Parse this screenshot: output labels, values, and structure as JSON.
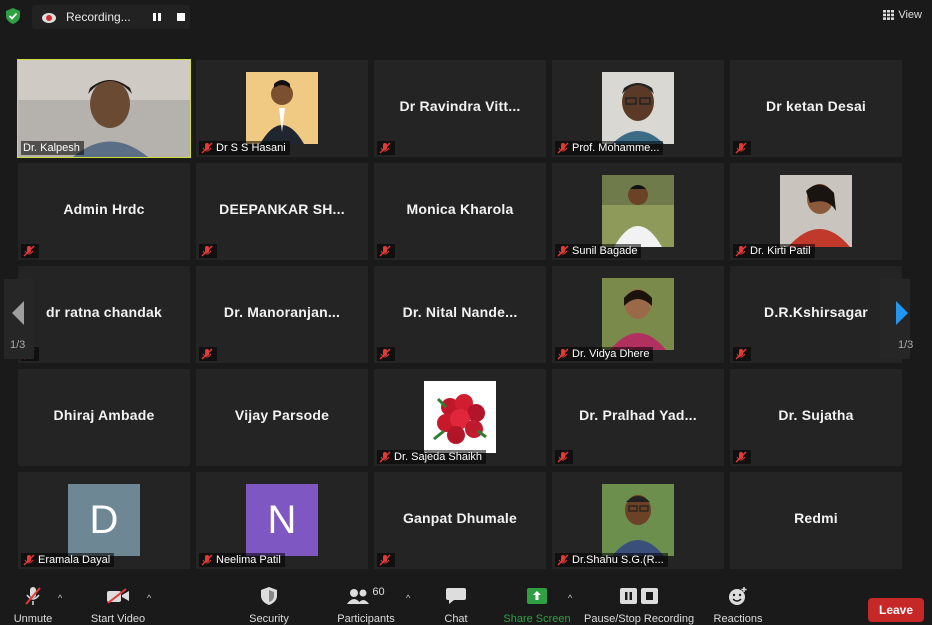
{
  "topbar": {
    "recording_label": "Recording...",
    "view_label": "View"
  },
  "tiles": [
    {
      "name": "",
      "label": "Dr. Kalpesh",
      "type": "video"
    },
    {
      "name": "",
      "label": "Dr S S Hasani",
      "type": "photo"
    },
    {
      "name": "Dr Ravindra Vitt...",
      "label": "",
      "type": "name"
    },
    {
      "name": "",
      "label": "Prof. Mohamme...",
      "type": "photo"
    },
    {
      "name": "Dr ketan Desai",
      "label": "",
      "type": "name"
    },
    {
      "name": "Admin Hrdc",
      "label": "",
      "type": "name"
    },
    {
      "name": "DEEPANKAR SH...",
      "label": "",
      "type": "name"
    },
    {
      "name": "Monica Kharola",
      "label": "",
      "type": "name"
    },
    {
      "name": "",
      "label": "Sunil Bagade",
      "type": "photo"
    },
    {
      "name": "",
      "label": "Dr. Kirti Patil",
      "type": "photo"
    },
    {
      "name": "dr ratna chandak",
      "label": "",
      "type": "name"
    },
    {
      "name": "Dr.  Manoranjan...",
      "label": "",
      "type": "name"
    },
    {
      "name": "Dr. Nital Nande...",
      "label": "",
      "type": "name"
    },
    {
      "name": "",
      "label": "Dr.  Vidya Dhere",
      "type": "photo"
    },
    {
      "name": "D.R.Kshirsagar",
      "label": "",
      "type": "name"
    },
    {
      "name": "Dhiraj Ambade",
      "label": "",
      "type": "name"
    },
    {
      "name": "Vijay Parsode",
      "label": "",
      "type": "name"
    },
    {
      "name": "",
      "label": "Dr. Sajeda Shaikh",
      "type": "photo"
    },
    {
      "name": "Dr. Pralhad  Yad...",
      "label": "",
      "type": "name"
    },
    {
      "name": "Dr. Sujatha",
      "label": "",
      "type": "name"
    },
    {
      "name": "",
      "label": "Eramala Dayal",
      "type": "avatar",
      "initial": "D",
      "color": "#6d8795"
    },
    {
      "name": "",
      "label": "Neelima Patil",
      "type": "avatar",
      "initial": "N",
      "color": "#7e57c2"
    },
    {
      "name": "Ganpat Dhumale",
      "label": "",
      "type": "name"
    },
    {
      "name": "",
      "label": "Dr.Shahu S.G.(R...",
      "type": "photo"
    },
    {
      "name": "Redmi",
      "label": "",
      "type": "name"
    }
  ],
  "pagination": {
    "left": "1/3",
    "right": "1/3"
  },
  "toolbar": {
    "unmute": "Unmute",
    "start_video": "Start Video",
    "security": "Security",
    "participants": "Participants",
    "participants_count": "60",
    "chat": "Chat",
    "share_screen": "Share Screen",
    "pause_stop_recording": "Pause/Stop Recording",
    "reactions": "Reactions",
    "leave": "Leave"
  },
  "colors": {
    "active_speaker_border": "#cddc39",
    "share_green": "#2ea043",
    "leave_red": "#c62828",
    "arrow_blue": "#2196f3"
  }
}
